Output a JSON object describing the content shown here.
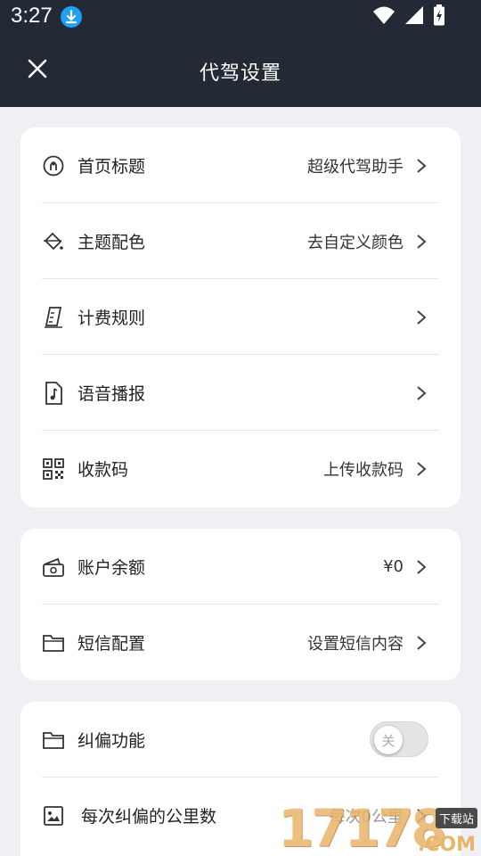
{
  "status_bar": {
    "time": "3:27",
    "download_icon": "download-icon",
    "wifi_icon": "wifi-icon",
    "signal_icon": "signal-icon",
    "battery_icon": "battery-charging-icon"
  },
  "toolbar": {
    "title": "代驾设置",
    "close_icon": "close-icon"
  },
  "card1": [
    {
      "label": "首页标题",
      "value": "超级代驾助手",
      "icon": "pin-icon"
    },
    {
      "label": "主题配色",
      "value": "去自定义颜色",
      "icon": "paint-bucket-icon"
    },
    {
      "label": "计费规则",
      "value": "",
      "icon": "ruler-icon"
    },
    {
      "label": "语音播报",
      "value": "",
      "icon": "music-file-icon"
    },
    {
      "label": "收款码",
      "value": "上传收款码",
      "icon": "qr-code-icon"
    }
  ],
  "card2": [
    {
      "label": "账户余额",
      "value": "¥0",
      "icon": "wallet-icon"
    },
    {
      "label": "短信配置",
      "value": "设置短信内容",
      "icon": "folder-icon"
    }
  ],
  "card3": {
    "correction": {
      "label": "纠偏功能",
      "toggle_text": "关",
      "enabled": false,
      "icon": "folder-icon"
    },
    "km": {
      "label": "每次纠偏的公里数",
      "value": "每次0公里",
      "icon": "photo-icon"
    }
  },
  "watermark": {
    "digits": "17178",
    "badge": "下载站",
    "suffix": ".COM"
  }
}
